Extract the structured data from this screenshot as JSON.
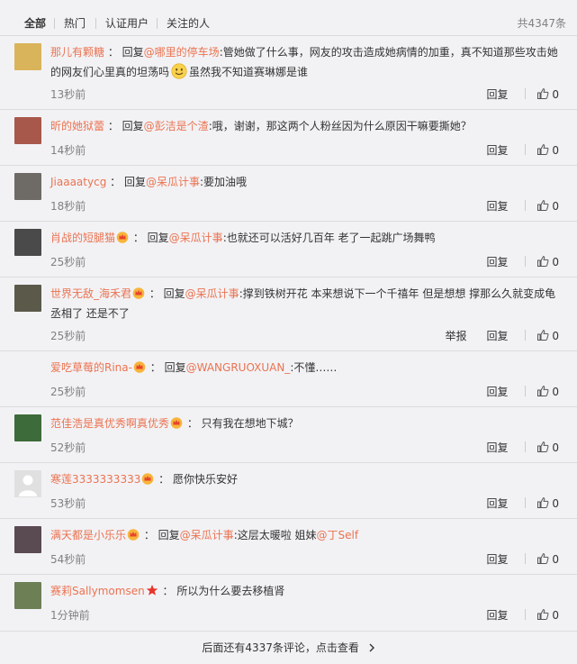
{
  "tabs": [
    "全部",
    "热门",
    "认证用户",
    "关注的人"
  ],
  "total": "共4347条",
  "labels": {
    "reply": "回复",
    "report": "举报"
  },
  "comments": [
    {
      "user": "那儿有颗糖",
      "sep": " ：",
      "pre": "回复",
      "mention": "@哪里的停车场",
      "text": ":管她做了什么事，网友的攻击造成她病情的加重，真不知道那些攻击她的网友们心里真的坦荡吗",
      "emoji": "smile-emoji",
      "post": "虽然我不知道赛琳娜是谁",
      "time": "13秒前",
      "likes": "0",
      "avatar_color": "#d9b45a"
    },
    {
      "user": "昕的她狱蕾",
      "sep": " ：",
      "pre": "回复",
      "mention": "@彭洁是个渣",
      "text": ":哦，谢谢，那这两个人粉丝因为什么原因干嘛要撕她？",
      "time": "14秒前",
      "likes": "0",
      "avatar_color": "#a8574b"
    },
    {
      "user": "Jiaaaatycg",
      "sep": " ：",
      "pre": "回复",
      "mention": "@呆瓜计事",
      "text": ":要加油哦",
      "time": "18秒前",
      "likes": "0",
      "avatar_color": "#6e6a66"
    },
    {
      "user": "肖战的短腿猫",
      "crown": true,
      "sep": " ：",
      "pre": "回复",
      "mention": "@呆瓜计事",
      "text": ":也就还可以活好几百年 老了一起跳广场舞鸭",
      "time": "25秒前",
      "likes": "0",
      "avatar_color": "#4a4a4a"
    },
    {
      "user": "世界无敌_海禾君",
      "crown": true,
      "sep": " ：",
      "pre": "回复",
      "mention": "@呆瓜计事",
      "text": ":撑到铁树开花 本来想说下一个千禧年 但是想想 撑那么久就变成龟丞相了 还是不了",
      "time": "25秒前",
      "likes": "0",
      "avatar_color": "#5b5a4a",
      "report": true
    },
    {
      "user": "爱吃草莓的Rina-",
      "crown": true,
      "sep": " ：",
      "pre": "回复",
      "mention": "@WANGRUOXUAN_",
      "text": ":不懂……",
      "time": "25秒前",
      "likes": "0",
      "avatar_color": ""
    },
    {
      "user": "范佳浩是真优秀啊真优秀",
      "crown": true,
      "sep": " ：",
      "text": "只有我在想地下城？",
      "time": "52秒前",
      "likes": "0",
      "avatar_color": "#3d6b3a"
    },
    {
      "user": "寒莲3333333333",
      "crown": true,
      "sep": " ：",
      "text": "愿你快乐安好",
      "time": "53秒前",
      "likes": "0",
      "avatar_color": "#d8d8d8"
    },
    {
      "user": "满天都是小乐乐",
      "crown": true,
      "sep": " ：",
      "pre": "回复",
      "mention": "@呆瓜计事",
      "text": ":这层太暖啦 姐妹",
      "mention2": "@丁Self",
      "time": "54秒前",
      "likes": "0",
      "avatar_color": "#5a4a52"
    },
    {
      "user": "赛莉Sallymomsen",
      "star": true,
      "sep": " ：",
      "text": "所以为什么要去移植肾",
      "time": "1分钟前",
      "likes": "0",
      "avatar_color": "#6c7f55"
    }
  ],
  "more": "后面还有4337条评论，点击查看"
}
